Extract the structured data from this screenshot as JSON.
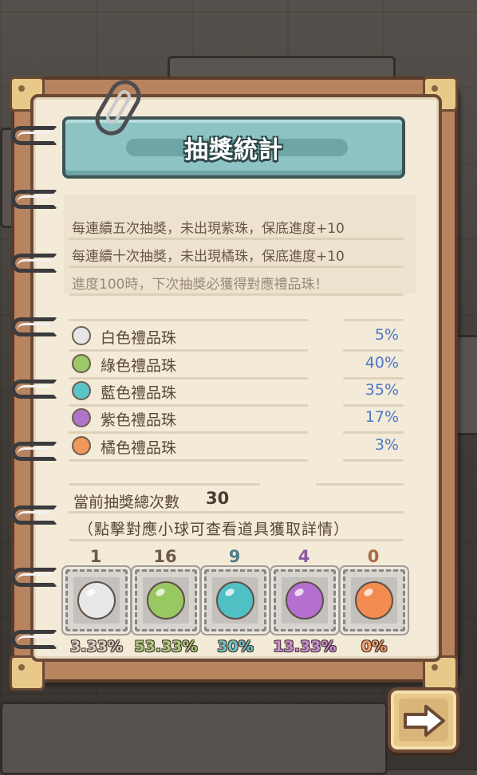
{
  "title": "抽獎統計",
  "rules": [
    "每連續五次抽獎，未出現紫珠，保底進度+10",
    "每連續十次抽獎，未出現橘珠，保底進度+10",
    "進度100時，下次抽獎必獲得對應禮品珠！"
  ],
  "probabilities": [
    {
      "label": "白色禮品珠",
      "value": "5%",
      "color": "#e6e6e6"
    },
    {
      "label": "綠色禮品珠",
      "value": "40%",
      "color": "#9cc86a"
    },
    {
      "label": "藍色禮品珠",
      "value": "35%",
      "color": "#5cc3c6"
    },
    {
      "label": "紫色禮品珠",
      "value": "17%",
      "color": "#b074c8"
    },
    {
      "label": "橘色禮品珠",
      "value": "3%",
      "color": "#f0975a"
    }
  ],
  "total": {
    "label": "當前抽獎總次數",
    "value": "30"
  },
  "hint": "（點擊對應小球可查看道具獲取詳情）",
  "results": [
    {
      "count": "1",
      "percent": "3.33%",
      "color": "#e8e8e8",
      "text_color": "#d6d0c4",
      "count_color": "#6b5a4c"
    },
    {
      "count": "16",
      "percent": "53.33%",
      "color": "#98c862",
      "text_color": "#a8cc7c",
      "count_color": "#6b5a4c"
    },
    {
      "count": "9",
      "percent": "30%",
      "color": "#4fc0c4",
      "text_color": "#6cc2c6",
      "count_color": "#4f7d8a"
    },
    {
      "count": "4",
      "percent": "13.33%",
      "color": "#b56fd0",
      "text_color": "#c98bd8",
      "count_color": "#8a5aa0"
    },
    {
      "count": "0",
      "percent": "0%",
      "color": "#f28c50",
      "text_color": "#f0a070",
      "count_color": "#a86840"
    }
  ],
  "icons": {
    "next": "arrow-right-icon",
    "clip": "paperclip-icon",
    "rings": "binder-ring-icon"
  }
}
